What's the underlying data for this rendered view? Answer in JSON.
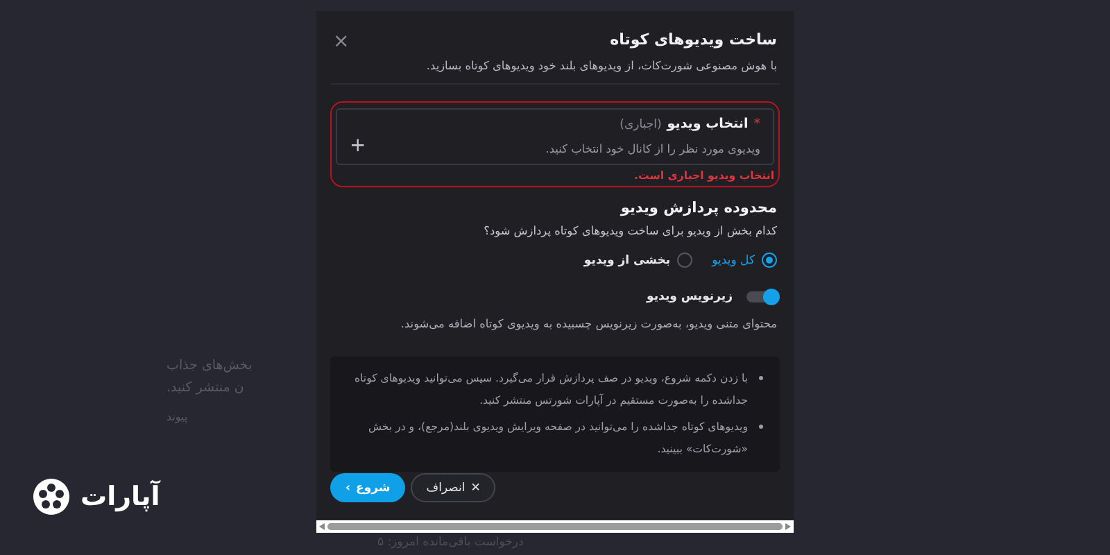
{
  "background": {
    "lines": [
      "بخش‌های جذاب",
      "ن منتشر کنید.",
      "پیوند"
    ],
    "quota": "درخواست باقی‌مانده امروز: ۵"
  },
  "logo": {
    "text": "آپارات"
  },
  "dialog": {
    "title": "ساخت ویدیوهای کوتاه",
    "subtitle": "با هوش مصنوعی شورت‌کات، از ویدیوهای بلند خود ویدیوهای کوتاه بسازید.",
    "close": "×",
    "video_field": {
      "required_mark": "*",
      "label": "انتخاب ویدیو",
      "hint": "(اجباری)",
      "description": "ویدیوی مورد نظر را از کانال خود انتخاب کنید.",
      "add": "+",
      "error": "انتخاب ویدیو اجباری است."
    },
    "range": {
      "title": "محدوده پردازش ویدیو",
      "question": "کدام بخش از ویدیو برای ساخت ویدیوهای کوتاه پردازش شود؟",
      "options": [
        {
          "label": "کل ویدیو",
          "selected": true
        },
        {
          "label": "بخشی از ویدیو",
          "selected": false
        }
      ]
    },
    "subtitles": {
      "label": "زیرنویس ویدیو",
      "on": true,
      "description": "محتوای متنی ویدیو، به‌صورت زیرنویس چسبیده به ویدیوی کوتاه اضافه می‌شوند."
    },
    "notes": [
      "با زدن دکمه شروع، ویدیو در صف پردازش قرار می‌گیرد. سپس می‌توانید ویدیوهای کوتاه جداشده را به‌صورت مستقیم در آپارات شورتس منتشر کنید.",
      "ویدیوهای کوتاه جداشده را می‌توانید در صفحه ویرایش ویدیوی بلند(مرجع)، و در بخش «شورت‌کات» ببینید."
    ],
    "buttons": [
      {
        "kind": "secondary",
        "label": "انصراف",
        "icon": "✕"
      },
      {
        "kind": "primary",
        "label": "شروع",
        "icon": "›"
      }
    ]
  }
}
